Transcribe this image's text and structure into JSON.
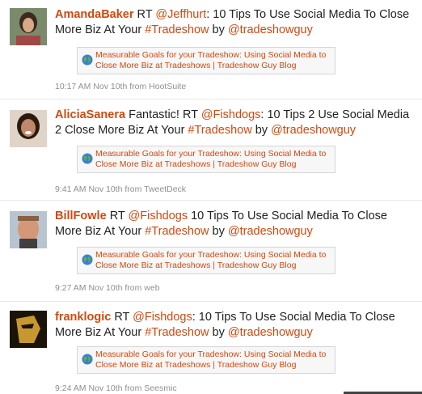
{
  "tweets": [
    {
      "user": "AmandaBaker",
      "rt": "RT",
      "mention": "@Jeffhurt",
      "text_after_mention": ": 10 Tips To Use Social Media To Close More Biz At Your ",
      "hashtag": "#Tradeshow",
      "by": " by ",
      "author": "@tradeshowguy",
      "link_title": "Measurable Goals for your Tradeshow: Using Social Media to Close More Biz at Tradeshows | Tradeshow Guy Blog",
      "meta": "10:17 AM Nov 10th from HootSuite"
    },
    {
      "user": "AliciaSanera",
      "rt": "Fantastic! RT",
      "mention": "@Fishdogs",
      "text_after_mention": ": 10 Tips 2 Use Social Media 2 Close More Biz At Your ",
      "hashtag": "#Tradeshow",
      "by": " by ",
      "author": "@tradeshowguy",
      "link_title": "Measurable Goals for your Tradeshow: Using Social Media to Close More Biz at Tradeshows | Tradeshow Guy Blog",
      "meta": "9:41 AM Nov 10th from TweetDeck"
    },
    {
      "user": "BillFowle",
      "rt": "RT",
      "mention": "@Fishdogs",
      "text_after_mention": " 10 Tips To Use Social Media To Close More Biz At Your ",
      "hashtag": "#Tradeshow",
      "by": " by ",
      "author": "@tradeshowguy",
      "link_title": "Measurable Goals for your Tradeshow: Using Social Media to Close More Biz at Tradeshows | Tradeshow Guy Blog",
      "meta": "9:27 AM Nov 10th from web"
    },
    {
      "user": "franklogic",
      "rt": "RT",
      "mention": "@Fishdogs",
      "text_after_mention": ": 10 Tips To Use Social Media To Close More Biz At Your ",
      "hashtag": "#Tradeshow",
      "by": " by ",
      "author": "@tradeshowguy",
      "link_title": "Measurable Goals for your Tradeshow: Using Social Media to Close More Biz at Tradeshows | Tradeshow Guy Blog",
      "meta": "9:24 AM Nov 10th from Seesmic"
    }
  ],
  "colors": {
    "link": "#d0490f",
    "meta": "#8f8f8f",
    "text": "#222222"
  },
  "icons": {
    "link_card": "globe-icon"
  }
}
